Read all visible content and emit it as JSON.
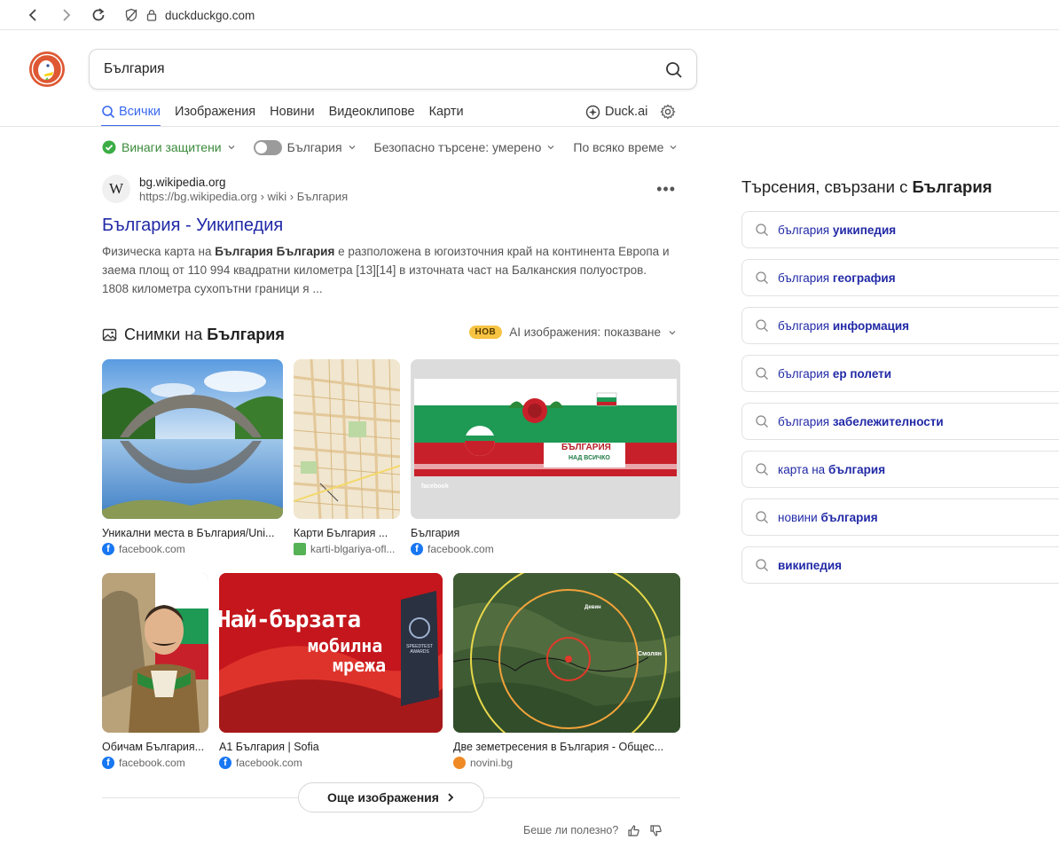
{
  "browser": {
    "url": "duckduckgo.com"
  },
  "search": {
    "query": "България"
  },
  "tabs": [
    {
      "label": "Всички"
    },
    {
      "label": "Изображения"
    },
    {
      "label": "Новини"
    },
    {
      "label": "Видеоклипове"
    },
    {
      "label": "Карти"
    }
  ],
  "tabs_right": {
    "duck_ai": "Duck.ai"
  },
  "filters": {
    "protected": "Винаги защитени",
    "region": "България",
    "safe_search": "Безопасно търсене: умерено",
    "time": "По всяко време"
  },
  "result": {
    "favicon_letter": "W",
    "domain": "bg.wikipedia.org",
    "url": "https://bg.wikipedia.org › wiki › България",
    "title": "България - Уикипедия",
    "snippet_1": "Физическа карта на ",
    "snippet_bold": "България България",
    "snippet_2": " е разположена в югоизточния край на континента Европа и заема площ от 110 994 квадратни километра [13][14] в източната част на Балканския полуостров. 1808 километра сухопътни граници я ..."
  },
  "images": {
    "heading_prefix": "Снимки на ",
    "heading_bold": "България",
    "badge": "НОВ",
    "ai_label": "AI изображения: показване",
    "items": [
      {
        "caption": "Уникални места в България/Uni...",
        "source": "facebook.com"
      },
      {
        "caption": "Карти България ...",
        "source": "karti-blgariya-ofl..."
      },
      {
        "caption": "България",
        "source": "facebook.com"
      },
      {
        "caption": "Обичам България...",
        "source": "facebook.com"
      },
      {
        "caption": "А1 България | Sofia",
        "source": "facebook.com"
      },
      {
        "caption": "Две земетресения в България - Общес...",
        "source": "novini.bg"
      }
    ],
    "banner_title": "БЪЛГАРИЯ",
    "banner_sub": "НАД ВСИЧКО",
    "banner_brand": "facebook",
    "a1_line1": "Най-бързата",
    "a1_line2": "мобилна",
    "a1_line3": "мрежа",
    "a1_award": "SPEEDTEST AWARDS",
    "map_label_1": "Смолян",
    "map_label_2": "Девин",
    "more_button": "Още изображения"
  },
  "feedback": {
    "question": "Беше ли полезно?"
  },
  "related": {
    "title_prefix": "Търсения, свързани с ",
    "title_bold": "България",
    "items": [
      {
        "normal": "българия ",
        "bold": "уикипедия"
      },
      {
        "normal": "българия ",
        "bold": "география"
      },
      {
        "normal": "българия ",
        "bold": "информация"
      },
      {
        "normal": "българия ",
        "bold": "ер полети"
      },
      {
        "normal": "българия ",
        "bold": "забележителности"
      },
      {
        "normal": "карта на ",
        "bold": "българия"
      },
      {
        "normal": "новини ",
        "bold": "българия"
      },
      {
        "normal": "",
        "bold": "википедия"
      }
    ]
  },
  "colors": {
    "accent": "#3969ef",
    "link": "#2129a6",
    "safe_green": "#3a8a3a",
    "new_badge": "#f6c343"
  }
}
